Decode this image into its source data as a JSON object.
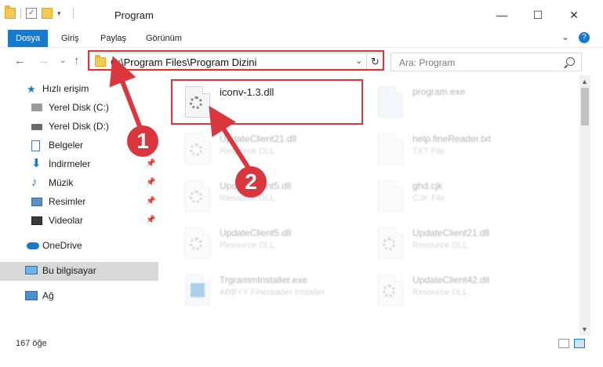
{
  "window": {
    "title": "Program",
    "minimize": "—",
    "maximize": "☐",
    "close": "✕"
  },
  "ribbon": {
    "tabs": [
      {
        "label": "Dosya",
        "active": true
      },
      {
        "label": "Giriş"
      },
      {
        "label": "Paylaş"
      },
      {
        "label": "Görünüm"
      }
    ],
    "expand": "⌄",
    "help": "?"
  },
  "nav": {
    "back": "←",
    "forward": "→",
    "recent": "⌄",
    "up": "↑",
    "address": "C:\\Program Files\\Program Dizini",
    "refresh": "↻",
    "search_placeholder": "Ara: Program"
  },
  "sidebar": {
    "items": [
      {
        "label": "Hızlı erişim",
        "icon": "star-icon"
      },
      {
        "label": "Yerel Disk (C:)",
        "icon": "drive-icon"
      },
      {
        "label": "Yerel Disk (D:)",
        "icon": "drive-icon"
      },
      {
        "label": "Belgeler",
        "icon": "documents-icon"
      },
      {
        "label": "İndirmeler",
        "icon": "download-icon"
      },
      {
        "label": "Müzik",
        "icon": "music-icon"
      },
      {
        "label": "Resimler",
        "icon": "pictures-icon"
      },
      {
        "label": "Videolar",
        "icon": "video-icon"
      },
      {
        "label": "OneDrive",
        "icon": "cloud-icon"
      },
      {
        "label": "Bu bilgisayar",
        "icon": "computer-icon"
      },
      {
        "label": "Ağ",
        "icon": "network-icon"
      }
    ]
  },
  "files": [
    {
      "name": "iconv-1.3.dll",
      "type": ""
    },
    {
      "name": "program.exe",
      "type": ""
    },
    {
      "name": "UpdateClient21.dll",
      "type": "Resource DLL"
    },
    {
      "name": "help.fineReader.txt",
      "type": "TXT File"
    },
    {
      "name": "UpdateClient5.dll",
      "type": "Resource DLL"
    },
    {
      "name": "ghd.cjk",
      "type": "CJK File"
    },
    {
      "name": "UpdateClient5.dll",
      "type": "Resource DLL"
    },
    {
      "name": "UpdateClient21.dll",
      "type": "Resource DLL"
    },
    {
      "name": "TrgrammInstaller.exe",
      "type": "ABBYY Finereader Installer"
    },
    {
      "name": "UpdateClient42.dll",
      "type": "Resource DLL"
    }
  ],
  "status": {
    "count": "167 öğe"
  },
  "callouts": [
    "1",
    "2"
  ],
  "colors": {
    "accent": "#1979ca",
    "highlight": "#d9363e"
  }
}
